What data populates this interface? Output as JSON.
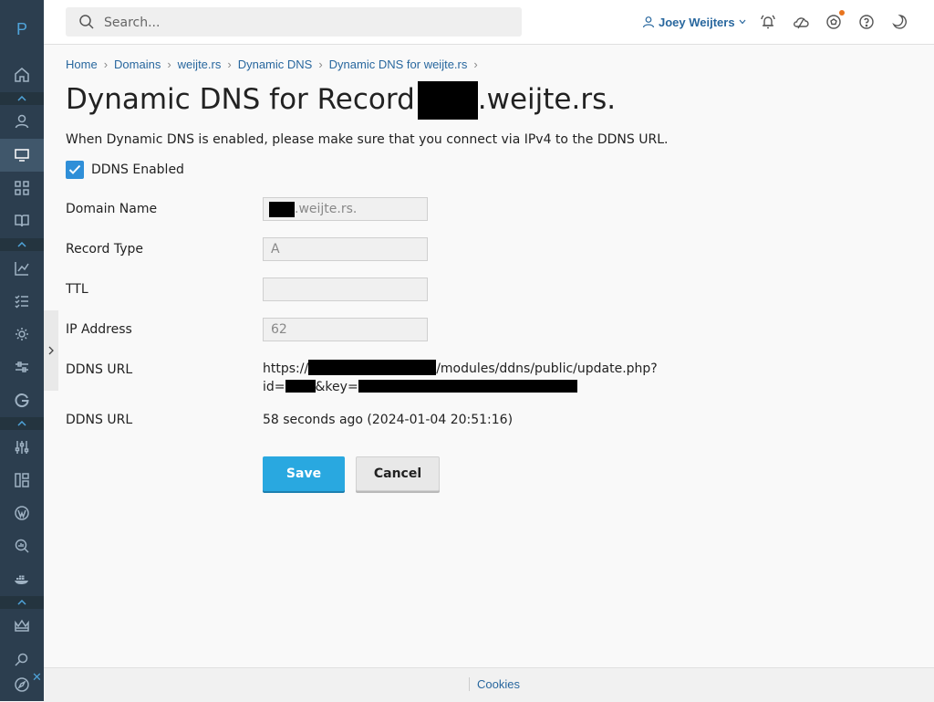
{
  "sidebar": {
    "logo": "P",
    "icons": [
      "home-icon",
      "user-icon",
      "websites-icon",
      "apps-icon",
      "book-icon",
      "stats-icon",
      "tasks-icon",
      "gear-icon",
      "tools-icon",
      "google-icon",
      "sliders-icon",
      "extensions-icon",
      "wordpress-icon",
      "seo-icon",
      "docker-icon",
      "crown-icon",
      "search-icon",
      "compass-icon"
    ]
  },
  "topbar": {
    "search_placeholder": "Search...",
    "user_name": "Joey Weijters",
    "icons": [
      "bell-icon",
      "cloud-icon",
      "soccer-ball-icon",
      "help-icon",
      "moon-icon"
    ]
  },
  "breadcrumb": [
    "Home",
    "Domains",
    "weijte.rs",
    "Dynamic DNS",
    "Dynamic DNS for weijte.rs"
  ],
  "page": {
    "title_prefix": "Dynamic DNS for Record",
    "title_suffix": ".weijte.rs.",
    "intro": "When Dynamic DNS is enabled, please make sure that you connect via IPv4 to the DDNS URL.",
    "ddns_enabled_label": "DDNS Enabled",
    "ddns_enabled": true
  },
  "form": {
    "domain_name_label": "Domain Name",
    "domain_name_value": ".weijte.rs.",
    "record_type_label": "Record Type",
    "record_type_value": "A",
    "ttl_label": "TTL",
    "ttl_value": "",
    "ip_label": "IP Address",
    "ip_value": "62",
    "ddns_url_label": "DDNS URL",
    "ddns_url_part1": "https://",
    "ddns_url_part2": "/modules/ddns/public/update.php?",
    "ddns_url_part3": "id=",
    "ddns_url_part4": "&key=",
    "last_update_label": "DDNS URL",
    "last_update_value": "58 seconds ago (2024-01-04 20:51:16)"
  },
  "buttons": {
    "save": "Save",
    "cancel": "Cancel"
  },
  "footer": {
    "cookies": "Cookies"
  },
  "colors": {
    "accent": "#29a8e0",
    "link": "#28679e",
    "sidebar": "#2c3e4f"
  }
}
